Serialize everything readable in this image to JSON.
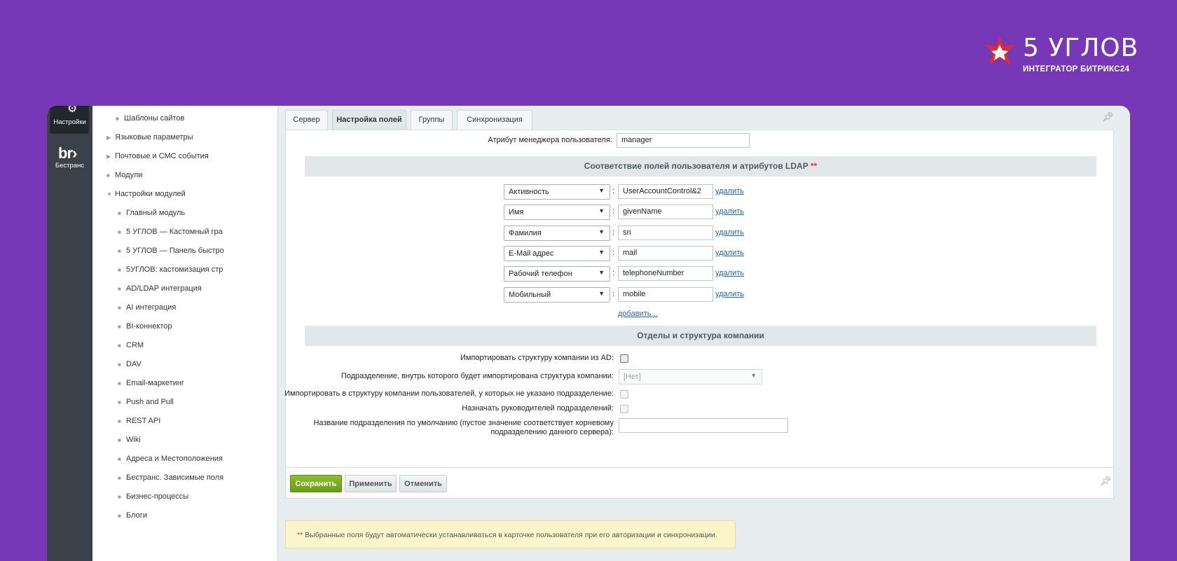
{
  "brand": {
    "title": "5 УГЛОВ",
    "subtitle": "ИНТЕГРАТОР БИТРИКС24"
  },
  "colors": {
    "background": "#7638b6",
    "accent_save": "#7aae1e",
    "link": "#2067b0",
    "required": "#dd3333"
  },
  "iconbar": {
    "items": [
      {
        "label": "Настройки",
        "icon": "gear-icon"
      },
      {
        "label": "Бестранс",
        "icon": "br-logo-icon"
      }
    ]
  },
  "sidebar": {
    "items": [
      {
        "label": "Шаблоны сайтов",
        "marker": "bullet"
      },
      {
        "label": "Языковые параметры",
        "marker": "arrow-right"
      },
      {
        "label": "Почтовые и СМС события",
        "marker": "arrow-right"
      },
      {
        "label": "Модули",
        "marker": "bullet"
      },
      {
        "label": "Настройки модулей",
        "marker": "arrow-down"
      },
      {
        "label": "Главный модуль",
        "marker": "bullet"
      },
      {
        "label": "5 УГЛОВ — Кастомный гра",
        "marker": "bullet"
      },
      {
        "label": "5 УГЛОВ — Панель быстро",
        "marker": "bullet"
      },
      {
        "label": "5УГЛОВ: кастомизация стр",
        "marker": "bullet"
      },
      {
        "label": "AD/LDAP интеграция",
        "marker": "bullet"
      },
      {
        "label": "AI интеграция",
        "marker": "bullet"
      },
      {
        "label": "BI-коннектор",
        "marker": "bullet"
      },
      {
        "label": "CRM",
        "marker": "bullet"
      },
      {
        "label": "DAV",
        "marker": "bullet"
      },
      {
        "label": "Email-маркетинг",
        "marker": "bullet"
      },
      {
        "label": "Push and Pull",
        "marker": "bullet"
      },
      {
        "label": "REST API",
        "marker": "bullet"
      },
      {
        "label": "Wiki",
        "marker": "bullet"
      },
      {
        "label": "Адреса и Местоположения",
        "marker": "bullet"
      },
      {
        "label": "Бестранс. Зависимые поля",
        "marker": "bullet"
      },
      {
        "label": "Бизнес-процессы",
        "marker": "bullet"
      },
      {
        "label": "Блоги",
        "marker": "bullet"
      }
    ]
  },
  "tabs": [
    {
      "label": "Сервер",
      "active": false
    },
    {
      "label": "Настройка полей",
      "active": true
    },
    {
      "label": "Группы",
      "active": false
    },
    {
      "label": "Синхронизация",
      "active": false
    }
  ],
  "form": {
    "manager_attr_label": "Атрибут менеджера пользователя:",
    "manager_attr_value": "manager",
    "mapping_section_title": "Соответствие полей пользователя и атрибутов LDAP",
    "required_mark": "**",
    "mappings": [
      {
        "field": "Активность",
        "attribute": "UserAccountControl&2",
        "delete_label": "удалить"
      },
      {
        "field": "Имя",
        "attribute": "givenName",
        "delete_label": "удалить"
      },
      {
        "field": "Фамилия",
        "attribute": "sn",
        "delete_label": "удалить"
      },
      {
        "field": "E-Mail адрес",
        "attribute": "mail",
        "delete_label": "удалить"
      },
      {
        "field": "Рабочий телефон",
        "attribute": "telephoneNumber",
        "delete_label": "удалить"
      },
      {
        "field": "Мобильный",
        "attribute": "mobile",
        "delete_label": "удалить"
      }
    ],
    "add_label": "добавить...",
    "structure_section_title": "Отделы и структура компании",
    "import_structure_label": "Импортировать структуру компании из AD:",
    "subdivision_label": "Подразделение, внутрь которого будет импортирована структура компании:",
    "subdivision_value": "[Нет]",
    "import_users_label": "Импортировать в структуру компании пользователей, у которых не указано подразделение:",
    "assign_heads_label": "Назначать руководителей подразделений:",
    "default_dept_label_1": "Название подразделения по умолчанию (пустое значение соответствует корневому",
    "default_dept_label_2": "подразделению данного сервера):",
    "default_dept_value": ""
  },
  "buttons": {
    "save": "Сохранить",
    "apply": "Применить",
    "cancel": "Отменить"
  },
  "note": {
    "mark": "**",
    "text": "Выбранные поля будут автоматически устанавливаться в карточке пользователя при его авторизации и синхронизации."
  }
}
